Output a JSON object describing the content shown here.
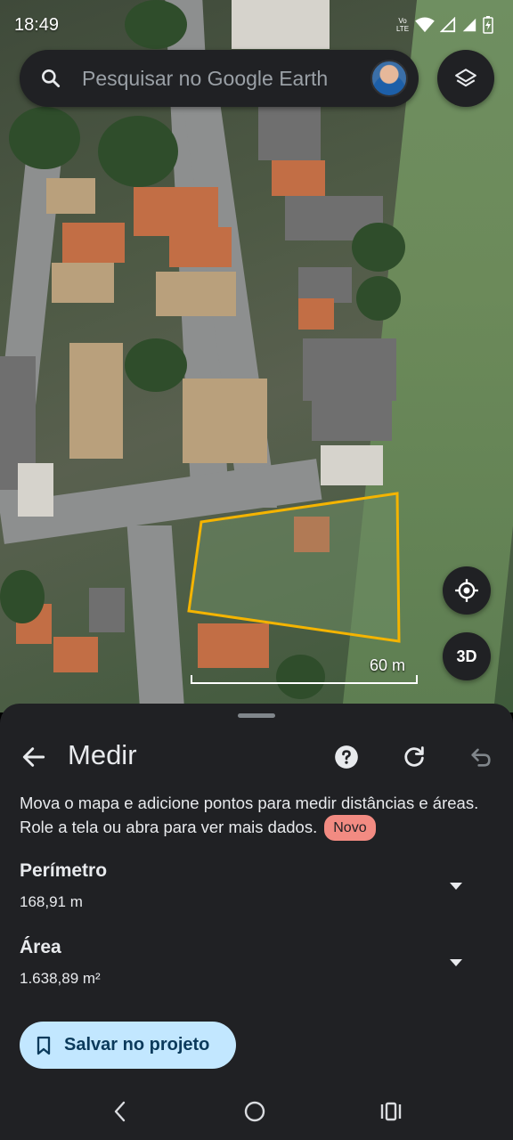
{
  "status_bar": {
    "time": "18:49",
    "network_label": "Vo LTE"
  },
  "search": {
    "placeholder": "Pesquisar no Google Earth"
  },
  "map": {
    "scale_label": "60 m",
    "three_d_label": "3D",
    "measure_color": "#f4b400"
  },
  "sheet": {
    "title": "Medir",
    "description": "Mova o mapa e adicione pontos para medir distâncias e áreas. Role a tela ou abra para ver mais dados.",
    "badge": "Novo",
    "metrics": [
      {
        "label": "Perímetro",
        "value": "168,91 m"
      },
      {
        "label": "Área",
        "value": "1.638,89 m²"
      }
    ],
    "save_label": "Salvar no projeto"
  },
  "colors": {
    "sheet_bg": "#202124",
    "save_bg": "#c2e7ff",
    "badge_bg": "#f28b82"
  }
}
